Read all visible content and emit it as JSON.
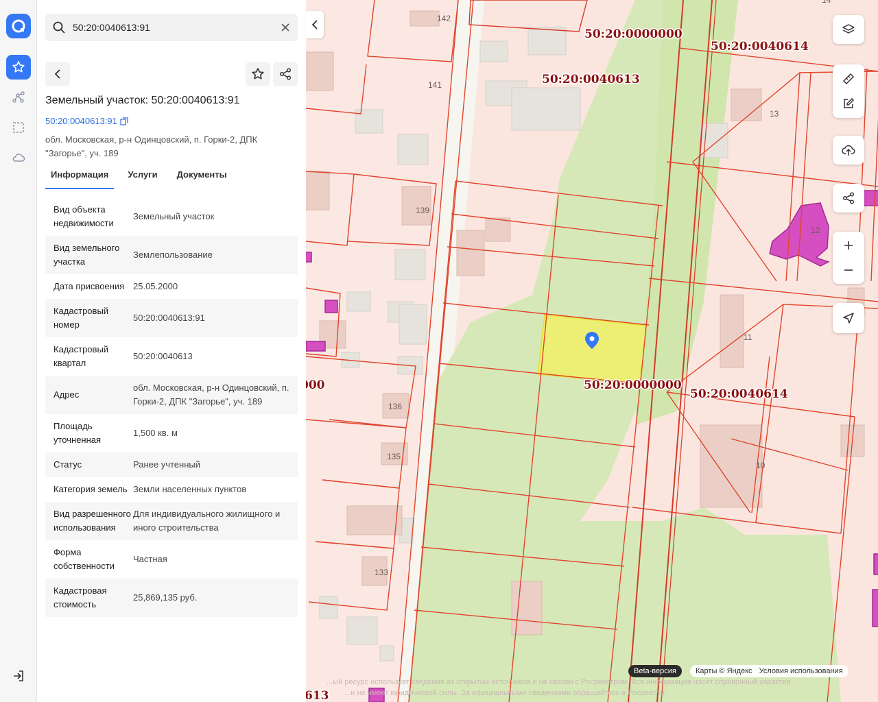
{
  "search": {
    "value": "50:20:0040613:91"
  },
  "panel": {
    "title": "Земельный участок: 50:20:0040613:91",
    "cad_link": "50:20:0040613:91",
    "address": "обл. Московская, р-н Одинцовский, п. Горки-2, ДПК \"Загорье\", уч. 189",
    "tabs": [
      {
        "label": "Информация"
      },
      {
        "label": "Услуги"
      },
      {
        "label": "Документы"
      }
    ],
    "rows": [
      {
        "key": "Вид объекта недвижимости",
        "value": "Земельный участок"
      },
      {
        "key": "Вид земельного участка",
        "value": "Землепользование"
      },
      {
        "key": "Дата присвоения",
        "value": "25.05.2000"
      },
      {
        "key": "Кадастровый номер",
        "value": "50:20:0040613:91"
      },
      {
        "key": "Кадастровый квартал",
        "value": "50:20:0040613"
      },
      {
        "key": "Адрес",
        "value": "обл. Московская, р-н Одинцовский, п. Горки-2, ДПК \"Загорье\", уч. 189"
      },
      {
        "key": "Площадь уточненная",
        "value": "1,500 кв. м"
      },
      {
        "key": "Статус",
        "value": "Ранее учтенный"
      },
      {
        "key": "Категория земель",
        "value": "Земли населенных пунктов"
      },
      {
        "key": "Вид разрешенного использования",
        "value": "Для индивидуального жилищного и иного строительства"
      },
      {
        "key": "Форма собственности",
        "value": "Частная"
      },
      {
        "key": "Кадастровая стоимость",
        "value": "25,869,135 руб."
      }
    ]
  },
  "map": {
    "labels": {
      "q0000000_top": "50:20:0000000",
      "q0040614_top": "50:20:0040614",
      "q0040613": "50:20:0040613",
      "q0000000_mid": "50:20:0000000",
      "q0040614_mid": "50:20:0040614",
      "q_left_cut": "000",
      "q_bottom_cut": "613"
    },
    "house_numbers": [
      "142",
      "141",
      "139",
      "136",
      "135",
      "133",
      "13",
      "12",
      "11",
      "10",
      "14"
    ],
    "disclaimer_1": "...ый ресурс использует сведения из открытых источников и не связан с Росреестром. Вся информация носит справочный характер",
    "disclaimer_2": "...и не имеет юридической силы. За официальными сведениями обращайтесь в Росреестр.",
    "beta": "Beta-версия",
    "yandex": "Карты © Яндекс",
    "terms": "Условия использования"
  },
  "colors": {
    "accent": "#3478f6",
    "parcel_line": "#e0452c",
    "highlight": "#e9ec6f",
    "label": "#8b1010"
  },
  "icons": [
    "logo-icon",
    "star-icon",
    "route-icon",
    "selection-icon",
    "cloud-icon",
    "logout-icon",
    "search-icon",
    "close-icon",
    "back-icon",
    "share-icon",
    "copy-icon",
    "layers-icon",
    "ruler-icon",
    "edit-icon",
    "upload-icon",
    "zoom-in-icon",
    "zoom-out-icon",
    "locate-icon",
    "pin-icon"
  ]
}
